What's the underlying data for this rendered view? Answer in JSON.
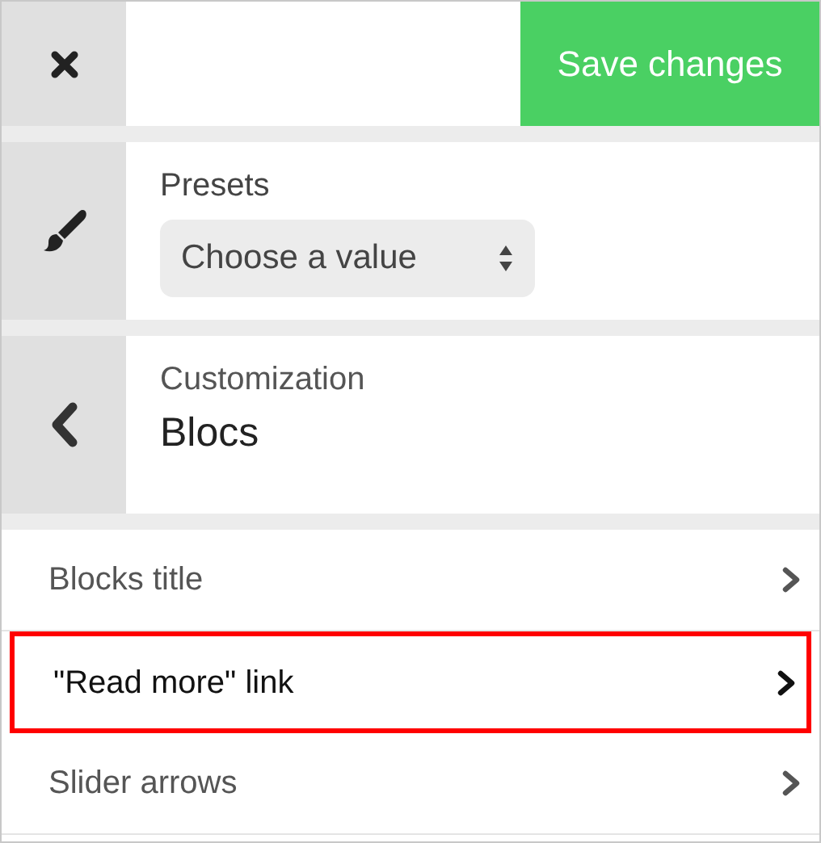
{
  "toolbar": {
    "save_button": "Save changes"
  },
  "presets": {
    "label": "Presets",
    "select": {
      "value": "Choose a value"
    }
  },
  "section": {
    "parent": "Customization",
    "title": "Blocs"
  },
  "items": [
    {
      "label": "Blocks title",
      "selected": false
    },
    {
      "label": "\"Read more\" link",
      "selected": true
    },
    {
      "label": "Slider arrows",
      "selected": false
    }
  ]
}
